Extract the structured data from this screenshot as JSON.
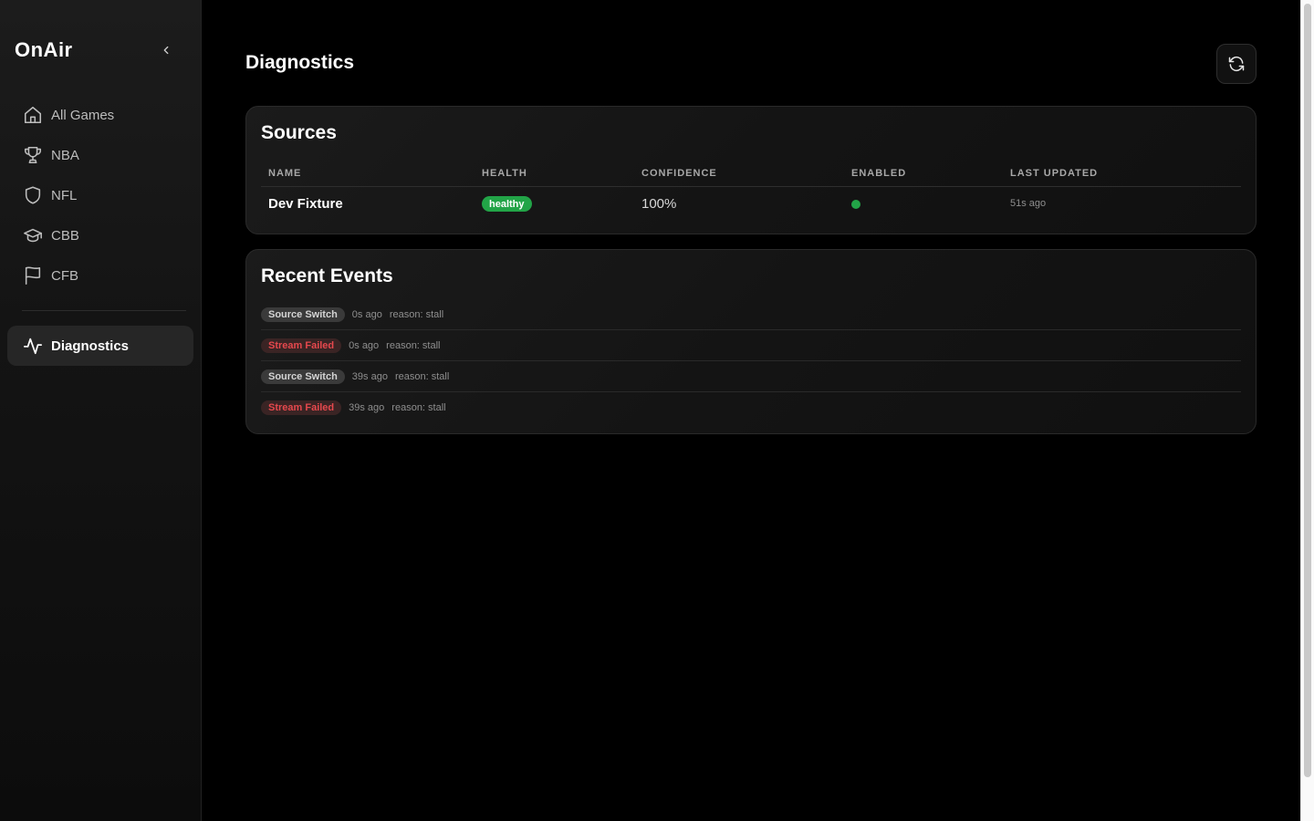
{
  "app": {
    "brand": "OnAir"
  },
  "sidebar": {
    "items": [
      {
        "label": "All Games",
        "icon": "home-icon"
      },
      {
        "label": "NBA",
        "icon": "trophy-icon"
      },
      {
        "label": "NFL",
        "icon": "shield-icon"
      },
      {
        "label": "CBB",
        "icon": "graduation-cap-icon"
      },
      {
        "label": "CFB",
        "icon": "flag-icon"
      }
    ],
    "active": {
      "label": "Diagnostics",
      "icon": "activity-icon"
    }
  },
  "main": {
    "title": "Diagnostics",
    "sources": {
      "title": "Sources",
      "columns": [
        "NAME",
        "HEALTH",
        "CONFIDENCE",
        "ENABLED",
        "LAST UPDATED"
      ],
      "rows": [
        {
          "name": "Dev Fixture",
          "health": "healthy",
          "confidence": "100%",
          "enabled": true,
          "last_updated": "51s ago"
        }
      ]
    },
    "events": {
      "title": "Recent Events",
      "items": [
        {
          "type": "Source Switch",
          "time": "0s ago",
          "reason": "reason: stall"
        },
        {
          "type": "Stream Failed",
          "time": "0s ago",
          "reason": "reason: stall"
        },
        {
          "type": "Source Switch",
          "time": "39s ago",
          "reason": "reason: stall"
        },
        {
          "type": "Stream Failed",
          "time": "39s ago",
          "reason": "reason: stall"
        }
      ]
    }
  },
  "colors": {
    "healthy": "#22a447",
    "failed": "#e5484d",
    "active_bg": "#262626"
  }
}
